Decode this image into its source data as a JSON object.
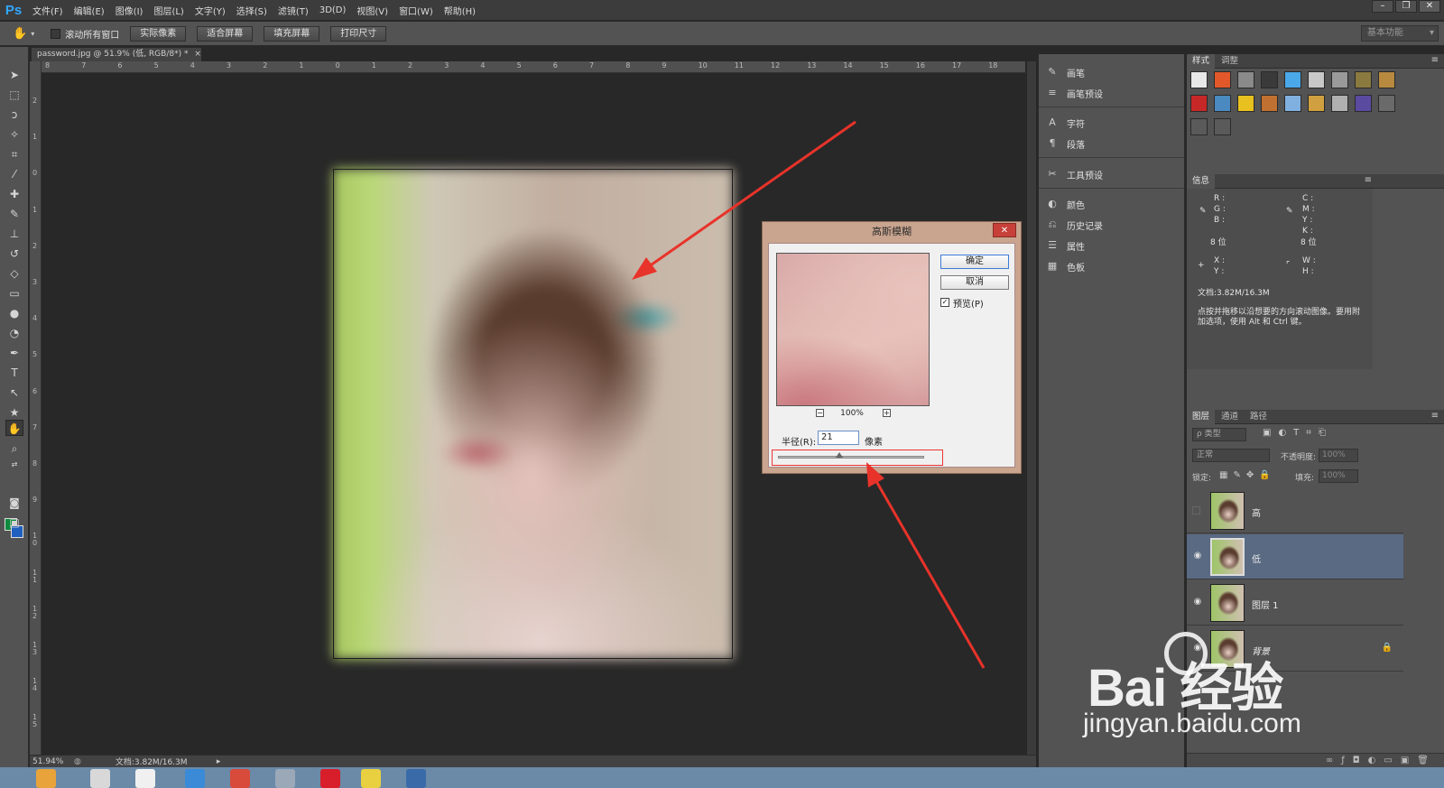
{
  "app": {
    "logo": "Ps",
    "menu": [
      "文件(F)",
      "编辑(E)",
      "图像(I)",
      "图层(L)",
      "文字(Y)",
      "选择(S)",
      "滤镜(T)",
      "3D(D)",
      "视图(V)",
      "窗口(W)",
      "帮助(H)"
    ],
    "window_controls": [
      "–",
      "❐",
      "✕"
    ]
  },
  "options_bar": {
    "scroll_all_label": "滚动所有窗口",
    "buttons": [
      "实际像素",
      "适合屏幕",
      "填充屏幕",
      "打印尺寸"
    ],
    "workspace": "基本功能"
  },
  "document": {
    "tab_title": "password.jpg @ 51.9% (低, RGB/8*) *",
    "tab_close": "×",
    "ruler_top": [
      "8",
      "7",
      "6",
      "5",
      "4",
      "3",
      "2",
      "1",
      "0",
      "1",
      "2",
      "3",
      "4",
      "5",
      "6",
      "7",
      "8",
      "9",
      "10",
      "11",
      "12",
      "13",
      "14",
      "15",
      "16",
      "17",
      "18"
    ],
    "ruler_left": [
      "2",
      "1",
      "0",
      "1",
      "2",
      "3",
      "4",
      "5",
      "6",
      "7",
      "8",
      "9",
      "1 0",
      "1 1",
      "1 2",
      "1 3",
      "1 4",
      "1 5"
    ]
  },
  "statusbar": {
    "zoom": "51.94%",
    "doc_size": "文档:3.82M/16.3M"
  },
  "dialog": {
    "title": "高斯模糊",
    "close": "✕",
    "ok": "确定",
    "cancel": "取消",
    "preview_label": "预览(P)",
    "preview_checked": "✓",
    "zoom_minus": "−",
    "zoom_plus": "+",
    "zoom_level": "100%",
    "radius_label": "半径(R):",
    "radius_value": "21",
    "radius_unit": "像素",
    "radius_slider_fraction": 0.42
  },
  "mid_panel": {
    "items": [
      {
        "icon": "brush-icon",
        "glyph": "✎",
        "label": "画笔"
      },
      {
        "icon": "brush-presets-icon",
        "glyph": "≡",
        "label": "画笔预设"
      },
      {
        "icon": "character-icon",
        "glyph": "A",
        "label": "字符"
      },
      {
        "icon": "paragraph-icon",
        "glyph": "¶",
        "label": "段落"
      },
      {
        "icon": "tool-presets-icon",
        "glyph": "✂",
        "label": "工具预设"
      },
      {
        "icon": "color-icon",
        "glyph": "◐",
        "label": "颜色"
      },
      {
        "icon": "history-icon",
        "glyph": "⎌",
        "label": "历史记录"
      },
      {
        "icon": "properties-icon",
        "glyph": "☰",
        "label": "属性"
      },
      {
        "icon": "swatches-icon",
        "glyph": "▦",
        "label": "色板"
      }
    ]
  },
  "styles_panel": {
    "tabs": [
      "样式",
      "调整"
    ],
    "colors": [
      "#e8e8e8",
      "#e2582a",
      "#8a8a8a",
      "#3a3a3a",
      "#4aa8e8",
      "#c8c8c8",
      "#9a9a9a",
      "#8a7a40",
      "#b88a40",
      "#c62828",
      "#4a8ac0",
      "#e8c020",
      "#c07030",
      "#80b0e0",
      "#d0a040",
      "#b0b0b0",
      "#5a4aa0",
      "#6a6a6a",
      "#5a5a5a",
      "#5a5a5a"
    ]
  },
  "info_panel": {
    "tab": "信息",
    "r": "R :",
    "g": "G :",
    "b": "B :",
    "c": "C :",
    "m": "M :",
    "y": "Y :",
    "k": "K :",
    "bits_left": "8 位",
    "bits_right": "8 位",
    "x": "X :",
    "y2": "Y :",
    "w": "W :",
    "h": "H :",
    "doc": "文档:3.82M/16.3M",
    "hint": "点按并拖移以沿想要的方向滚动图像。要用附加选项，使用 Alt 和 Ctrl 键。"
  },
  "layers_panel": {
    "tabs": [
      "图层",
      "通道",
      "路径"
    ],
    "filter_kind": "ρ 类型",
    "blend_mode": "正常",
    "opacity_label": "不透明度:",
    "opacity_value": "100%",
    "lock_label": "锁定:",
    "fill_label": "填充:",
    "fill_value": "100%",
    "layers": [
      {
        "name": "高",
        "visible": false,
        "selected": false,
        "locked": false
      },
      {
        "name": "低",
        "visible": true,
        "selected": true,
        "locked": false
      },
      {
        "name": "图层 1",
        "visible": true,
        "selected": false,
        "locked": false
      },
      {
        "name": "背景",
        "visible": true,
        "selected": false,
        "locked": true
      }
    ]
  },
  "watermark": {
    "brand": "Bai 经验",
    "url": "jingyan.baidu.com"
  },
  "colors": {
    "foreground": "#0f8a3c",
    "background": "#1f5fbf",
    "arrow": "#e8332a",
    "selection": "#596a82"
  }
}
